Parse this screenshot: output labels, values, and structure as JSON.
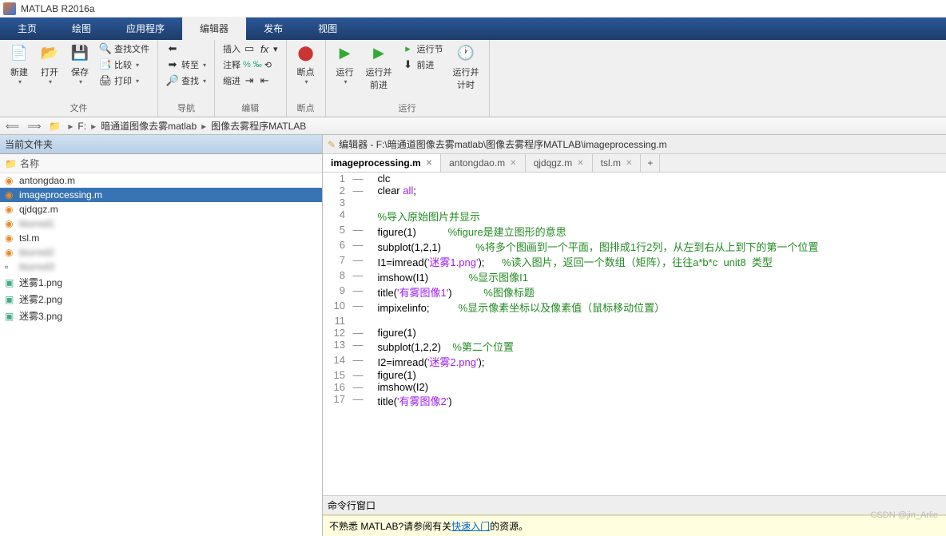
{
  "window": {
    "title": "MATLAB R2016a"
  },
  "tabs": {
    "home": "主页",
    "plots": "绘图",
    "apps": "应用程序",
    "editor": "编辑器",
    "publish": "发布",
    "view": "视图"
  },
  "ribbon": {
    "file_group": "文件",
    "new": "新建",
    "open": "打开",
    "save": "保存",
    "find_files": "查找文件",
    "compare": "比较",
    "print": "打印",
    "nav_group": "导航",
    "goto": "转至",
    "find": "查找",
    "edit_group": "编辑",
    "insert": "插入",
    "fx": "fx",
    "comment": "注释",
    "indent": "缩进",
    "breakpoint_group": "断点",
    "breakpoints": "断点",
    "run_group": "运行",
    "run": "运行",
    "run_advance": "运行并\n前进",
    "run_section": "运行节",
    "advance": "前进",
    "run_time": "运行并\n计时"
  },
  "breadcrumb": {
    "drive": "F:",
    "p1": "暗通道图像去雾matlab",
    "p2": "图像去雾程序MATLAB"
  },
  "sidebar": {
    "title": "当前文件夹",
    "name_col": "名称",
    "files": [
      {
        "name": "antongdao.m",
        "type": "m",
        "sel": false
      },
      {
        "name": "imageprocessing.m",
        "type": "m",
        "sel": true
      },
      {
        "name": "qjdqgz.m",
        "type": "m",
        "sel": false
      },
      {
        "name": "blurred1",
        "type": "m",
        "sel": false,
        "blur": true
      },
      {
        "name": "tsl.m",
        "type": "m",
        "sel": false
      },
      {
        "name": "blurred2",
        "type": "m",
        "sel": false,
        "blur": true
      },
      {
        "name": "blurred3",
        "type": "other",
        "sel": false,
        "blur": true
      },
      {
        "name": "迷雾1.png",
        "type": "png",
        "sel": false
      },
      {
        "name": "迷雾2.png",
        "type": "png",
        "sel": false
      },
      {
        "name": "迷雾3.png",
        "type": "png",
        "sel": false
      }
    ]
  },
  "editor": {
    "title": "编辑器 - F:\\暗通道图像去雾matlab\\图像去雾程序MATLAB\\imageprocessing.m",
    "tabs": [
      {
        "name": "imageprocessing.m",
        "active": true
      },
      {
        "name": "antongdao.m",
        "active": false
      },
      {
        "name": "qjdqgz.m",
        "active": false
      },
      {
        "name": "tsl.m",
        "active": false
      }
    ],
    "code": [
      {
        "n": 1,
        "d": true,
        "tokens": [
          {
            "t": "clc",
            "c": "normal"
          }
        ]
      },
      {
        "n": 2,
        "d": true,
        "tokens": [
          {
            "t": "clear ",
            "c": "normal"
          },
          {
            "t": "all",
            "c": "string"
          },
          {
            "t": ";",
            "c": "normal"
          }
        ]
      },
      {
        "n": 3,
        "d": false,
        "tokens": []
      },
      {
        "n": 4,
        "d": false,
        "tokens": [
          {
            "t": "%导入原始图片并显示",
            "c": "comment"
          }
        ]
      },
      {
        "n": 5,
        "d": true,
        "tokens": [
          {
            "t": "figure(1)           ",
            "c": "normal"
          },
          {
            "t": "%figure是建立图形的意思",
            "c": "comment"
          }
        ]
      },
      {
        "n": 6,
        "d": true,
        "tokens": [
          {
            "t": "subplot(1,2,1)            ",
            "c": "normal"
          },
          {
            "t": "%将多个图画到一个平面，图排成1行2列，从左到右从上到下的第一个位置",
            "c": "comment"
          }
        ]
      },
      {
        "n": 7,
        "d": true,
        "tokens": [
          {
            "t": "I1=imread(",
            "c": "normal"
          },
          {
            "t": "'迷雾1.png'",
            "c": "string"
          },
          {
            "t": ");      ",
            "c": "normal"
          },
          {
            "t": "%读入图片，返回一个数组（矩阵），往往a*b*c  unit8  类型",
            "c": "comment"
          }
        ]
      },
      {
        "n": 8,
        "d": true,
        "tokens": [
          {
            "t": "imshow(I1)              ",
            "c": "normal"
          },
          {
            "t": "%显示图像I1",
            "c": "comment"
          }
        ]
      },
      {
        "n": 9,
        "d": true,
        "tokens": [
          {
            "t": "title(",
            "c": "normal"
          },
          {
            "t": "'有雾图像1'",
            "c": "string"
          },
          {
            "t": ")           ",
            "c": "normal"
          },
          {
            "t": "%图像标题",
            "c": "comment"
          }
        ]
      },
      {
        "n": 10,
        "d": true,
        "tokens": [
          {
            "t": "impixelinfo;          ",
            "c": "normal"
          },
          {
            "t": "%显示像素坐标以及像素值（鼠标移动位置）",
            "c": "comment"
          }
        ]
      },
      {
        "n": 11,
        "d": false,
        "tokens": []
      },
      {
        "n": 12,
        "d": true,
        "tokens": [
          {
            "t": "figure(1)",
            "c": "normal"
          }
        ]
      },
      {
        "n": 13,
        "d": true,
        "tokens": [
          {
            "t": "subplot(1,2,2)    ",
            "c": "normal"
          },
          {
            "t": "%第二个位置",
            "c": "comment"
          }
        ]
      },
      {
        "n": 14,
        "d": true,
        "tokens": [
          {
            "t": "I2=imread(",
            "c": "normal"
          },
          {
            "t": "'迷雾2.png'",
            "c": "string"
          },
          {
            "t": ");",
            "c": "normal"
          }
        ]
      },
      {
        "n": 15,
        "d": true,
        "tokens": [
          {
            "t": "figure(1)",
            "c": "normal"
          }
        ]
      },
      {
        "n": 16,
        "d": true,
        "tokens": [
          {
            "t": "imshow(I2)",
            "c": "normal"
          }
        ]
      },
      {
        "n": 17,
        "d": true,
        "tokens": [
          {
            "t": "title(",
            "c": "normal"
          },
          {
            "t": "'有雾图像2'",
            "c": "string"
          },
          {
            "t": ")",
            "c": "normal"
          }
        ]
      }
    ]
  },
  "cmd": {
    "title": "命令行窗口",
    "hint_pre": "不熟悉 MATLAB?请参阅有关",
    "hint_link": "快速入门",
    "hint_post": "的资源。"
  },
  "watermark": "CSDN @jin_Arlie"
}
